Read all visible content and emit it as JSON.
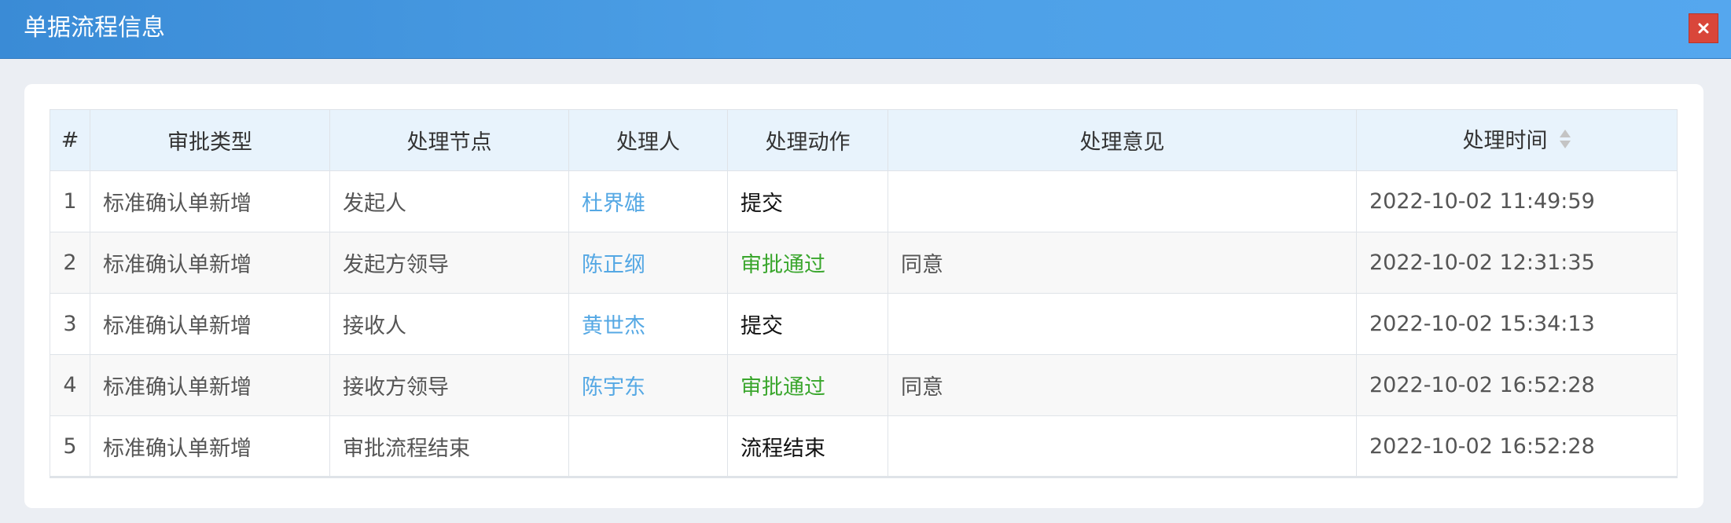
{
  "window": {
    "title": "单据流程信息",
    "close_icon": "close-icon"
  },
  "colors": {
    "titlebar": "#4c9fe6",
    "close_button": "#d9463a",
    "header_row": "#e8f3fc",
    "link": "#55a8e4",
    "approved": "#3aa62d"
  },
  "table": {
    "columns": {
      "idx": "#",
      "type": "审批类型",
      "node": "处理节点",
      "handler": "处理人",
      "action": "处理动作",
      "opinion": "处理意见",
      "time": "处理时间"
    },
    "sort_icon": "sort-icon",
    "rows": [
      {
        "idx": "1",
        "type": "标准确认单新增",
        "node": "发起人",
        "handler": "杜界雄",
        "action": "提交",
        "opinion": "",
        "time": "2022-10-02 11:49:59"
      },
      {
        "idx": "2",
        "type": "标准确认单新增",
        "node": "发起方领导",
        "handler": "陈正纲",
        "action": "审批通过",
        "opinion": "同意",
        "time": "2022-10-02 12:31:35"
      },
      {
        "idx": "3",
        "type": "标准确认单新增",
        "node": "接收人",
        "handler": "黄世杰",
        "action": "提交",
        "opinion": "",
        "time": "2022-10-02 15:34:13"
      },
      {
        "idx": "4",
        "type": "标准确认单新增",
        "node": "接收方领导",
        "handler": "陈宇东",
        "action": "审批通过",
        "opinion": "同意",
        "time": "2022-10-02 16:52:28"
      },
      {
        "idx": "5",
        "type": "标准确认单新增",
        "node": "审批流程结束",
        "handler": "",
        "action": "流程结束",
        "opinion": "",
        "time": "2022-10-02 16:52:28"
      }
    ]
  }
}
